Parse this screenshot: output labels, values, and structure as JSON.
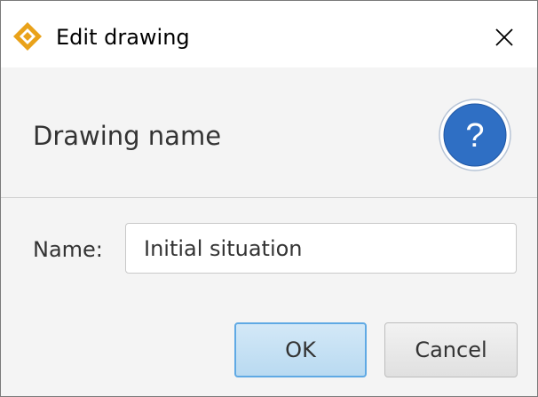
{
  "window": {
    "title": "Edit drawing",
    "app_icon": "geogebra-diamond-icon",
    "close_icon": "close-icon"
  },
  "header": {
    "heading": "Drawing name",
    "help_icon": "question-mark-icon"
  },
  "form": {
    "name_label": "Name:",
    "name_value": "Initial situation"
  },
  "buttons": {
    "ok_label": "OK",
    "cancel_label": "Cancel"
  },
  "colors": {
    "accent": "#5fa9e4",
    "help_icon_blue": "#2f6fc4",
    "app_icon_orange": "#e9a21a"
  }
}
